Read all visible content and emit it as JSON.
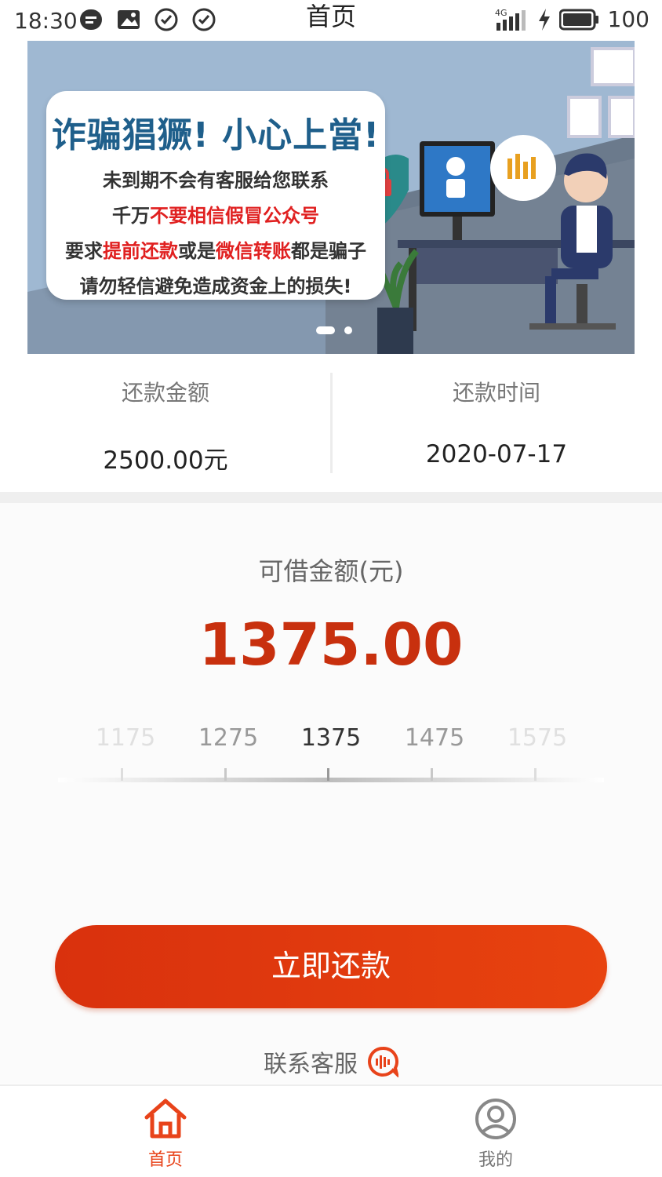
{
  "status_bar": {
    "time": "18:30",
    "title": "首页",
    "network": "4G",
    "battery": "100"
  },
  "banner": {
    "title": "诈骗猖獗! 小心上當!",
    "line1": "未到期不会有客服给您联系",
    "line2_prefix": "千万",
    "line2_red": "不要相信假冒公众号",
    "line3_prefix": "要求",
    "line3_red1": "提前还款",
    "line3_mid": "或是",
    "line3_red2": "微信转账",
    "line3_suffix": "都是骗子",
    "line4": "请勿轻信避免造成资金上的损失!",
    "slide_count": 2,
    "active_slide": 1
  },
  "repayment": {
    "amount_label": "还款金额",
    "amount_value": "2500.00元",
    "date_label": "还款时间",
    "date_value": "2020-07-17"
  },
  "loan": {
    "label": "可借金额(元)",
    "amount": "1375.00",
    "ruler": [
      "1175",
      "1275",
      "1375",
      "1475",
      "1575"
    ],
    "selected_index": 2
  },
  "actions": {
    "repay_button": "立即还款",
    "contact_service": "联系客服"
  },
  "tabs": {
    "home": "首页",
    "mine": "我的"
  },
  "colors": {
    "accent": "#d9310d",
    "amount": "#c8300e"
  }
}
